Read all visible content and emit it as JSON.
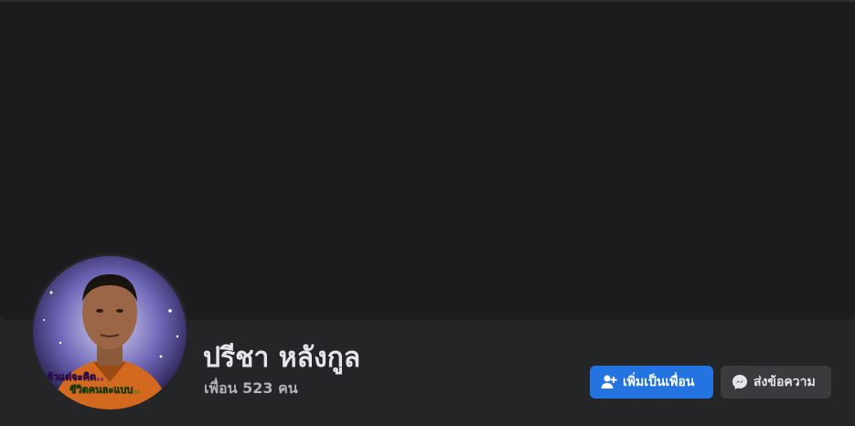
{
  "profile": {
    "name": "ปรีชา หลังกูล",
    "friends_count": "เพื่อน 523 คน",
    "avatar_text_line1": "แล้วแต่จะคิด..",
    "avatar_text_line2": "ชีวิตคนละแบบ.."
  },
  "actions": {
    "add_friend_label": "เพิ่มเป็นเพื่อน",
    "add_friend_icon": "add-person-icon",
    "message_label": "ส่งข้อความ",
    "message_icon": "messenger-icon"
  },
  "colors": {
    "page_bg": "#242526",
    "cover_bg": "#1b1c1e",
    "primary_button": "#2374e1",
    "secondary_button": "#3a3b3c"
  }
}
